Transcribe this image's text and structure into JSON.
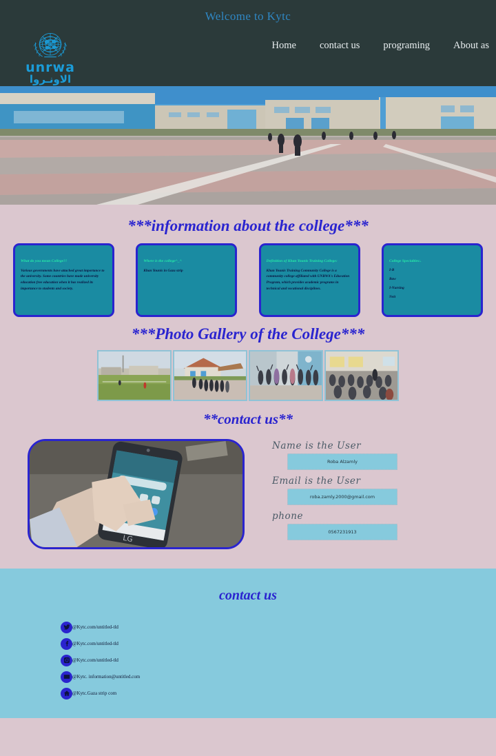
{
  "header": {
    "welcome": "Welcome to Kytc",
    "logo_word": "unrwa",
    "logo_arabic": "الاونـروا",
    "nav": [
      {
        "label": "Home"
      },
      {
        "label": "contact us"
      },
      {
        "label": "programing"
      },
      {
        "label": "About as"
      }
    ]
  },
  "sections": {
    "info_title": "***information about the college***",
    "gallery_title": "***Photo Gallery of the College***",
    "contact_title": "**contact us**"
  },
  "cards": [
    {
      "title": "What do you mean College?!",
      "body": "Various governments have attached great importance to the university. Some countries have made university education free education when it has realized its importance to students and society."
    },
    {
      "title": "Where is the college^_^",
      "body": "Khan Younis in Gaza strip"
    },
    {
      "title": "Definition of Khan Younis Training College:",
      "body": "Khan Younis Training Community College is a community college affiliated with UNRWA's Education Program, which provides academic programs in technical and vocational disciplines."
    },
    {
      "title": "College Specialties:.",
      "items": [
        "I-B",
        "Baw",
        "I-Nursing",
        "Neit"
      ]
    }
  ],
  "gallery": [
    {
      "caption": "college-field-photo"
    },
    {
      "caption": "college-entrance-group-photo"
    },
    {
      "caption": "students-celebrating-photo"
    },
    {
      "caption": "classroom-hall-photo"
    }
  ],
  "contact_form": {
    "phone_image_caption": "hand-holding-lg-phone",
    "fields": [
      {
        "label": "Name is the User",
        "value": "Roba Alzamly"
      },
      {
        "label": "Email is the User",
        "value": "roba.zamly.2000@gmail.com"
      },
      {
        "label": "phone",
        "value": "0567231913"
      }
    ]
  },
  "footer": {
    "title": "contact us",
    "links": [
      {
        "icon": "twitter-icon",
        "text": "@Kytc.com/untitled-tld"
      },
      {
        "icon": "facebook-icon",
        "text": "@Kytc.com/untitled-tld"
      },
      {
        "icon": "instagram-icon",
        "text": "@Kytc.com/untitled-tld"
      },
      {
        "icon": "envelope-icon",
        "text": "@Kytc. information@untitled.com"
      },
      {
        "icon": "home-icon",
        "text": "@Kytc.Gaza strip com"
      }
    ]
  },
  "colors": {
    "header_bg": "#2b3a3a",
    "page_bg": "#dbc7cf",
    "accent_blue": "#2a24cf",
    "card_bg": "#1a8ba2",
    "footer_bg": "#86cadd",
    "logo_blue": "#1b9cd8"
  }
}
